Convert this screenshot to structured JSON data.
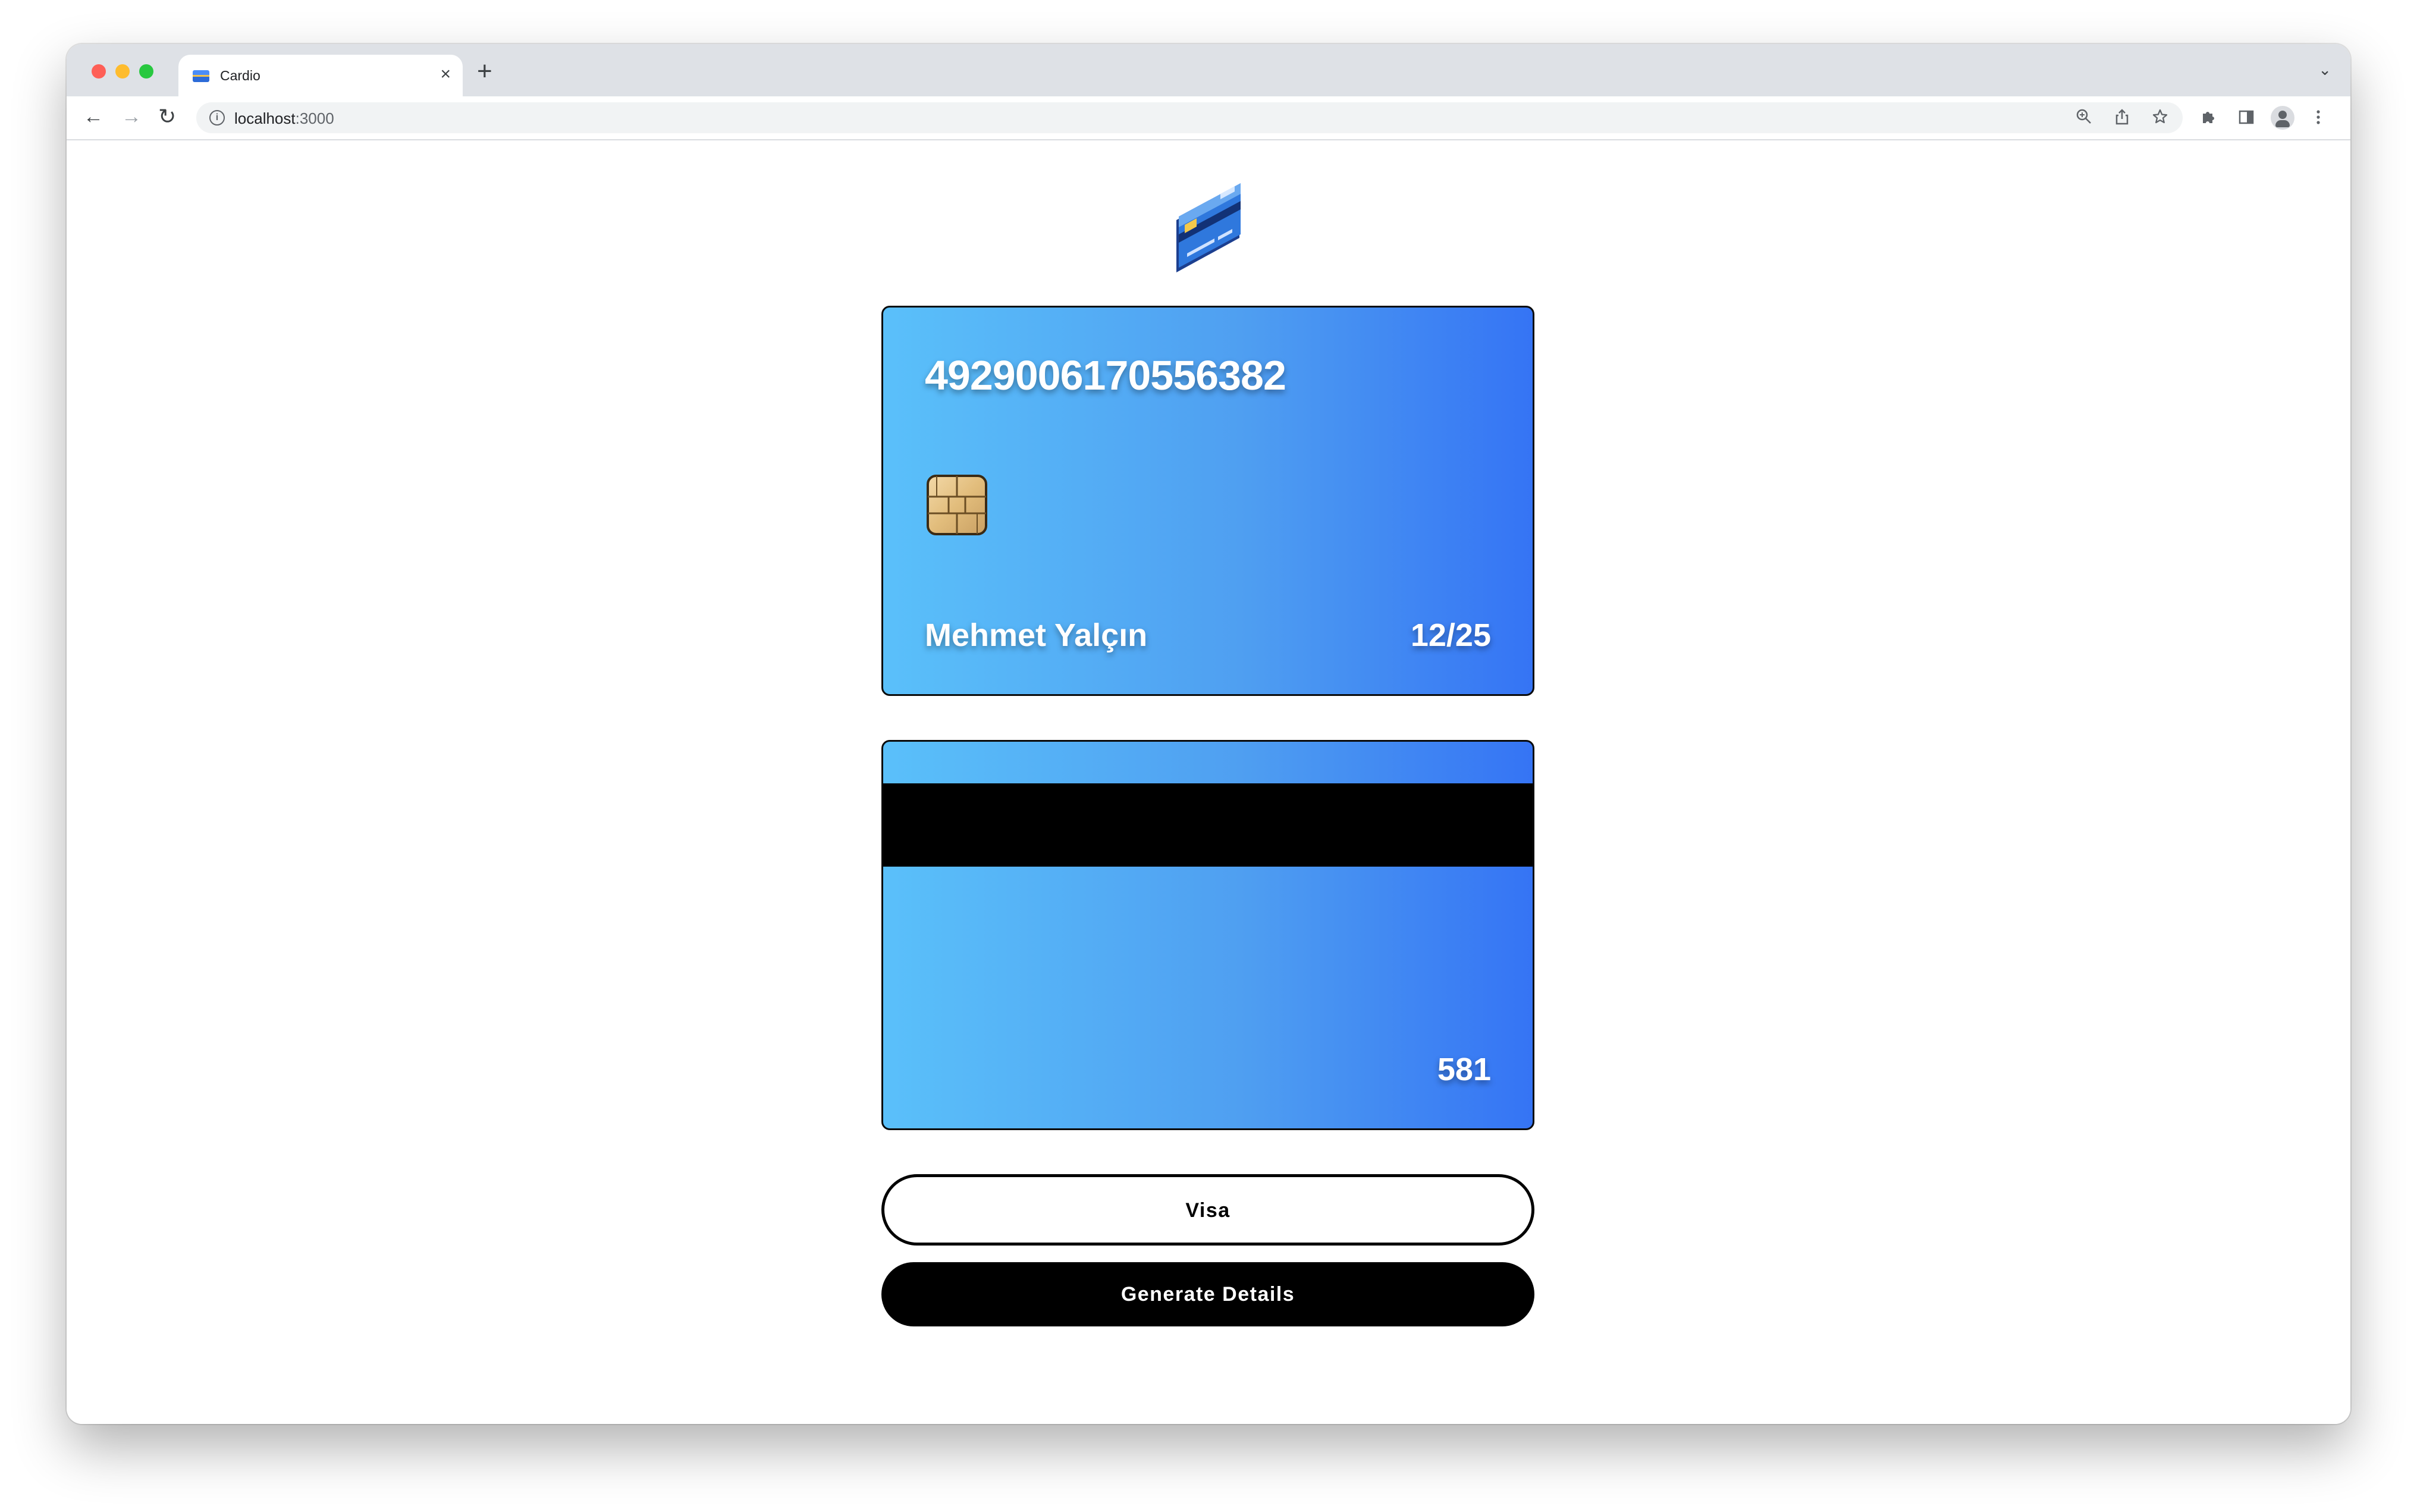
{
  "browser": {
    "tab_title": "Cardio",
    "tab_close": "×",
    "new_tab": "+",
    "tab_list": "⌄",
    "url_host": "localhost",
    "url_port": ":3000",
    "nav": {
      "back": "←",
      "forward": "→",
      "reload": "↻"
    },
    "omnibox_icons": [
      "zoom-icon",
      "share-icon",
      "star-icon"
    ],
    "toolbar_icons": [
      "extensions-icon",
      "side-panel-icon",
      "profile-icon",
      "menu-icon"
    ]
  },
  "app": {
    "logo": "credit-card-icon",
    "card_front": {
      "number": "4929006170556382",
      "holder": "Mehmet Yalçın",
      "expiry": "12/25"
    },
    "card_back": {
      "cvv": "581"
    },
    "buttons": {
      "card_type": "Visa",
      "generate": "Generate Details"
    },
    "colors": {
      "card_gradient_start": "#5ac0fa",
      "card_gradient_end": "#3574f4",
      "stripe": "#000000",
      "primary_button": "#000000"
    }
  }
}
